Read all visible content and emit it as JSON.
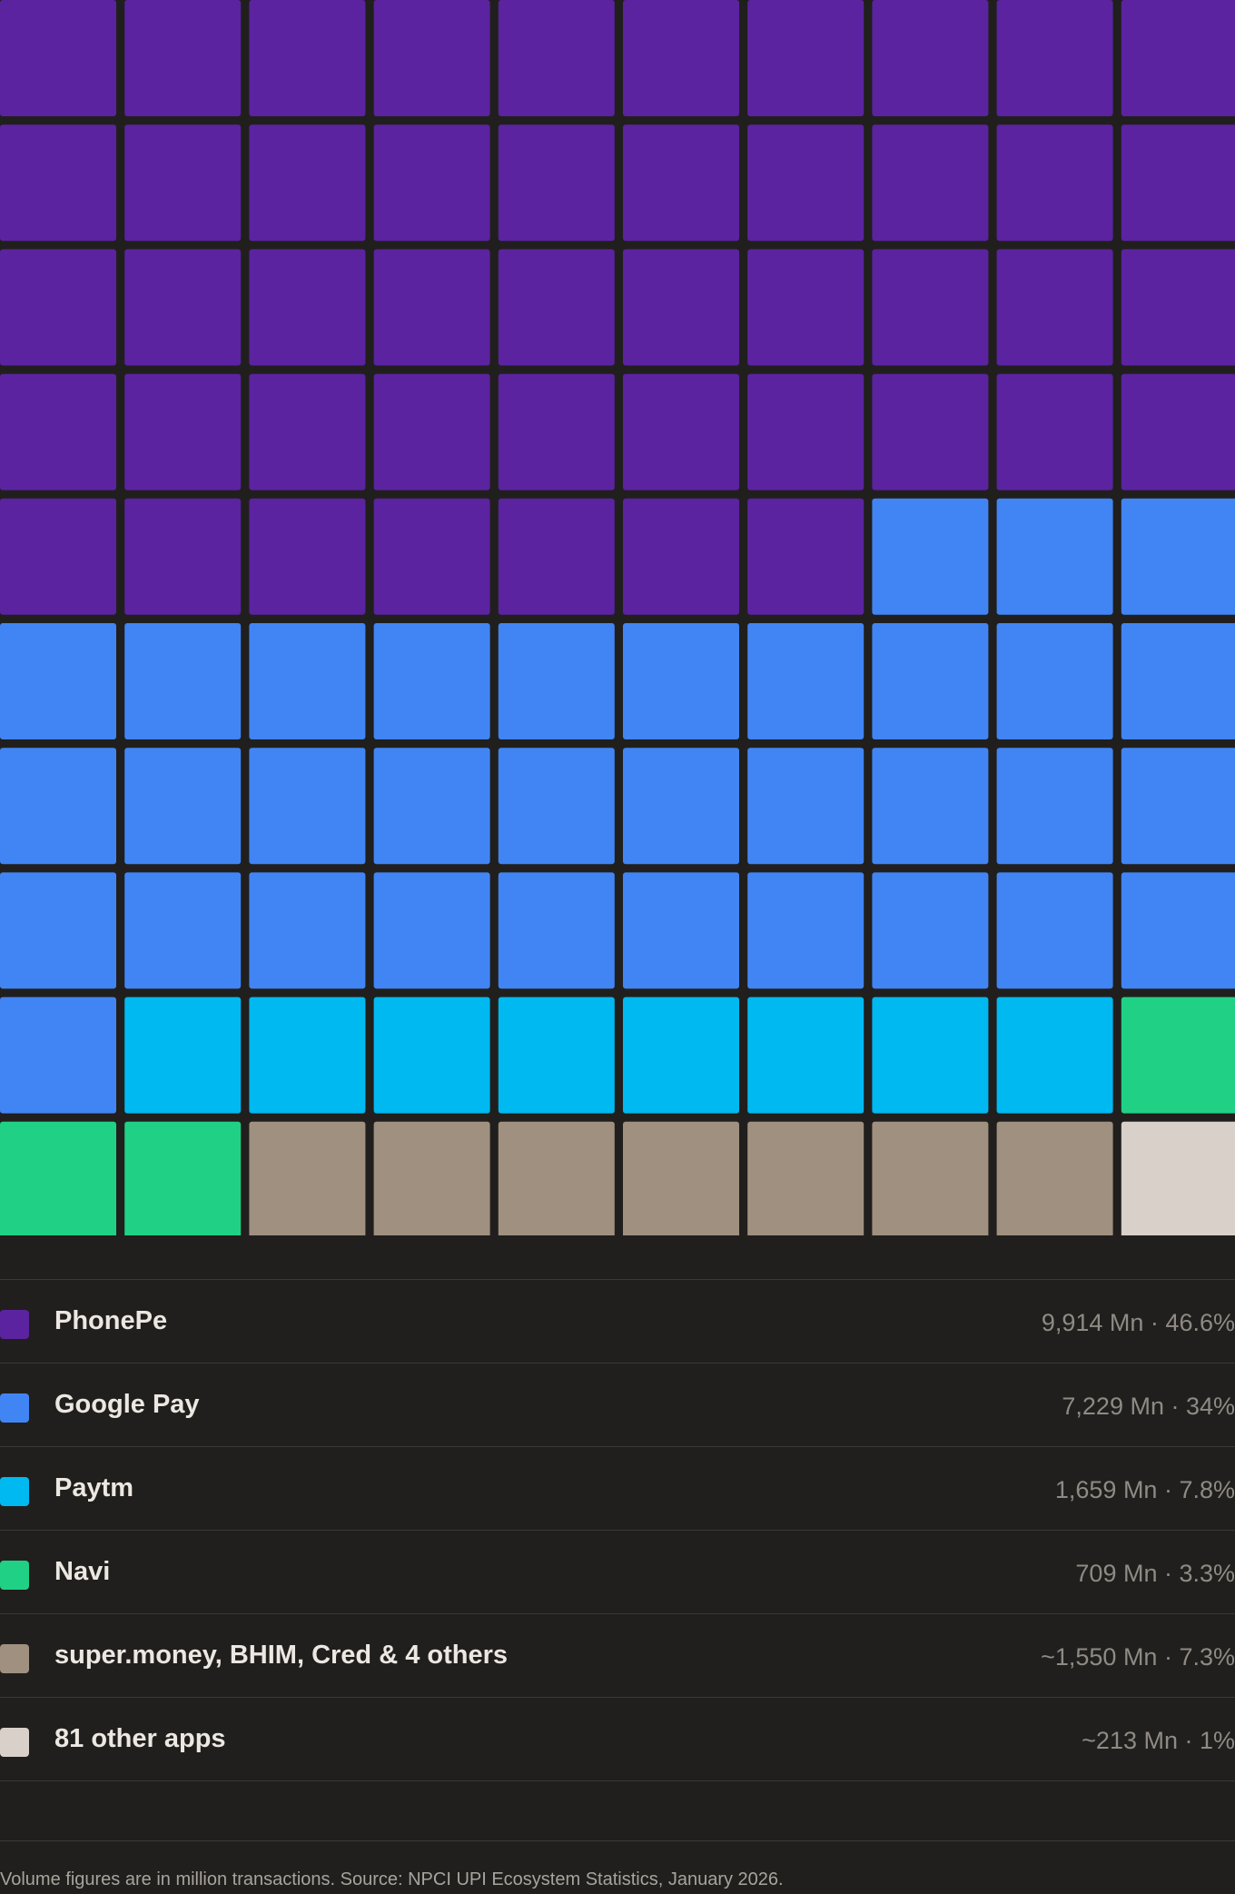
{
  "chart_data": {
    "type": "waffle",
    "grid": {
      "rows": 10,
      "columns": 10,
      "total_cells": 100
    },
    "unit": "Mn",
    "series": [
      {
        "name": "PhonePe",
        "volume_text": "9,914 Mn",
        "volume_mn": 9914,
        "share_text": "46.6%",
        "share_pct": 46.6,
        "cells": 47,
        "color": "#5b23a0"
      },
      {
        "name": "Google Pay",
        "volume_text": "7,229 Mn",
        "volume_mn": 7229,
        "share_text": "34%",
        "share_pct": 34,
        "cells": 34,
        "color": "#4185f4"
      },
      {
        "name": "Paytm",
        "volume_text": "1,659 Mn",
        "volume_mn": 1659,
        "share_text": "7.8%",
        "share_pct": 7.8,
        "cells": 8,
        "color": "#00b9f1"
      },
      {
        "name": "Navi",
        "volume_text": "709 Mn",
        "volume_mn": 709,
        "share_text": "3.3%",
        "share_pct": 3.3,
        "cells": 3,
        "color": "#20d185"
      },
      {
        "name": "super.money, BHIM, Cred & 4 others",
        "volume_text": "~1,550 Mn",
        "volume_mn": 1550,
        "share_text": "7.3%",
        "share_pct": 7.3,
        "cells": 7,
        "color": "#a09080"
      },
      {
        "name": "81 other apps",
        "volume_text": "~213 Mn",
        "volume_mn": 213,
        "share_text": "1%",
        "share_pct": 1,
        "cells": 1,
        "color": "#d8d0c9"
      }
    ],
    "value_separator": " · ",
    "footnote": "Volume figures are in million transactions. Source: NPCI UPI Ecosystem Statistics, January 2026."
  },
  "colors": {
    "background": "#201f1d",
    "divider": "#3a3936",
    "label": "#ece7e1",
    "value": "#8f8a84",
    "footnote": "#a8a39d"
  }
}
